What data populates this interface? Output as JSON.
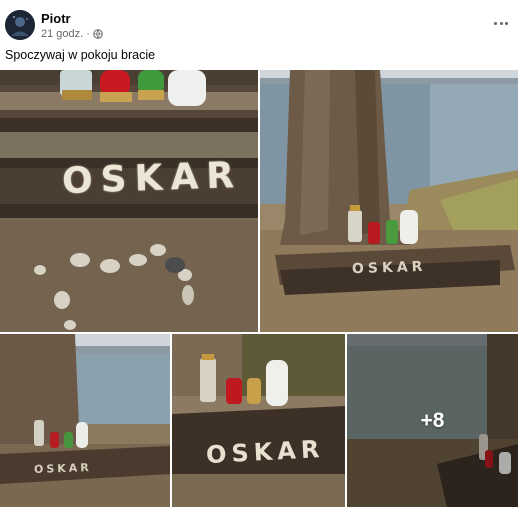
{
  "post": {
    "author": "Piotr",
    "timestamp": "21 godz.",
    "separator": "·",
    "privacy_icon": "globe-icon",
    "more_icon": "more-options-icon",
    "caption": "Spoczywaj w pokoju bracie"
  },
  "photos": {
    "name_on_stones": "OSKAR",
    "more_count": "+8"
  },
  "colors": {
    "text_primary": "#050505",
    "text_secondary": "#65676b",
    "background": "#ffffff"
  }
}
